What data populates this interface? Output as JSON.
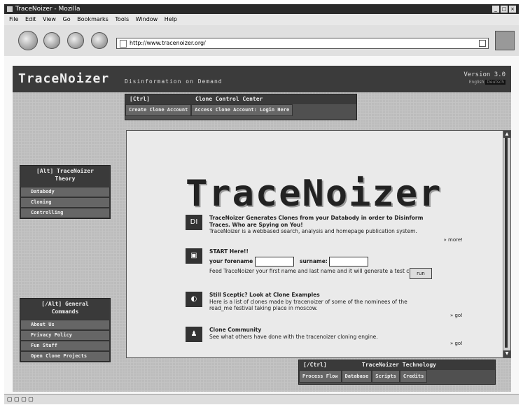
{
  "window": {
    "title": "TraceNoizer - Mozilla",
    "controls": [
      "_",
      "□",
      "×"
    ]
  },
  "menu": [
    "File",
    "Edit",
    "View",
    "Go",
    "Bookmarks",
    "Tools",
    "Window",
    "Help"
  ],
  "nav": {
    "url": "http://www.tracenoizer.org/"
  },
  "header": {
    "logo": "TraceNoizer",
    "tagline": "Disinformation on Demand",
    "version": "Version 3.0",
    "language_label": "English",
    "language_selected": "Deutsch"
  },
  "control_center": {
    "hotkey": "[Ctrl]",
    "title": "Clone Control Center",
    "buttons": [
      "Create Clone Account",
      "Access Clone Account: Login Here"
    ]
  },
  "theory": {
    "title_line1": "[Alt] TraceNoizer",
    "title_line2": "Theory",
    "items": [
      "Databody",
      "Cloning",
      "Controlling"
    ]
  },
  "general": {
    "title_line1": "[/Alt] General",
    "title_line2": "Commands",
    "items": [
      "About Us",
      "Privacy Policy",
      "Fun Stuff",
      "Open Clone Projects"
    ]
  },
  "main": {
    "big_logo": "TraceNoizer",
    "intro": {
      "icon": "DI",
      "heading": "TraceNoizer Generates Clones from your Databody in order to Disinform Traces. Who are Spying on You!",
      "text": "TraceNoizer is a webbased search, analysis and homepage publication system.",
      "more": "» more!"
    },
    "start": {
      "heading": "START Here!!",
      "forename_label": "your forename",
      "surname_label": "surname:",
      "text": "Feed TraceNoizer your first name and last name and it will generate a test clone.",
      "run_label": "run"
    },
    "examples": {
      "heading": "Still Sceptic? Look at Clone Examples",
      "text": "Here is a list of clones made by tracenoizer of some of the nominees of the read_me festival taking place in moscow.",
      "go": "» go!"
    },
    "community": {
      "heading": "Clone Community",
      "text": "See what others have done with the tracenoizer cloning engine.",
      "go": "» go!"
    }
  },
  "technology": {
    "hotkey": "[/Ctrl]",
    "title": "TraceNoizer Technology",
    "buttons": [
      "Process Flow",
      "Database",
      "Scripts",
      "Credits"
    ]
  }
}
